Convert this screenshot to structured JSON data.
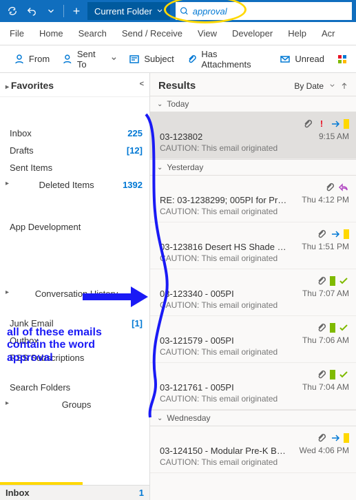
{
  "titlebar": {
    "folder_dd": "Current Folder",
    "search_value": "approval"
  },
  "menu": {
    "file": "File",
    "home": "Home",
    "search": "Search",
    "sendrec": "Send / Receive",
    "view": "View",
    "developer": "Developer",
    "help": "Help",
    "acr": "Acr"
  },
  "toolbar": {
    "from": "From",
    "sentto": "Sent To",
    "subject": "Subject",
    "attach": "Has Attachments",
    "unread": "Unread"
  },
  "nav": {
    "favorites": "Favorites",
    "inbox_bottom": "Inbox",
    "inbox_bottom_count": "1",
    "folders": [
      {
        "name": "Inbox",
        "count": "225",
        "exp": false
      },
      {
        "name": "Drafts",
        "count": "[12]",
        "exp": false
      },
      {
        "name": "Sent Items",
        "count": "",
        "exp": false
      },
      {
        "name": "Deleted Items",
        "count": "1392",
        "exp": true
      },
      {
        "name": "App Development",
        "count": "",
        "exp": false
      },
      {
        "name": "Conversation History",
        "count": "",
        "exp": true
      },
      {
        "name": "Junk Email",
        "count": "[1]",
        "exp": false
      },
      {
        "name": "Outbox",
        "count": "",
        "exp": false
      },
      {
        "name": "RSS Subscriptions",
        "count": "",
        "exp": false
      },
      {
        "name": "Search Folders",
        "count": "",
        "exp": false
      },
      {
        "name": "Groups",
        "count": "",
        "exp": true
      }
    ]
  },
  "results": {
    "title": "Results",
    "sort": "By Date",
    "groups": {
      "today": "Today",
      "yesterday": "Yesterday",
      "wednesday": "Wednesday"
    },
    "caution": "CAUTION: This email originated",
    "emails": {
      "e1": {
        "subject": "03-123802",
        "time": "9:15 AM"
      },
      "e2": {
        "subject": "RE: 03-1238299; 005PI for Proc…",
        "time": "Thu 4:12 PM"
      },
      "e3": {
        "subject": "03-123816 Desert HS Shade St…",
        "time": "Thu 1:51 PM"
      },
      "e4": {
        "subject": "03-123340 - 005PI",
        "time": "Thu 7:07 AM"
      },
      "e5": {
        "subject": "03-121579 - 005PI",
        "time": "Thu 7:06 AM"
      },
      "e6": {
        "subject": "03-121761 - 005PI",
        "time": "Thu 7:04 AM"
      },
      "e7": {
        "subject": "03-124150 - Modular Pre-K Bui…",
        "time": "Wed 4:06 PM"
      }
    }
  },
  "annotation": {
    "line1": "all of these emails",
    "line2": "contain the word",
    "line3": "approval"
  }
}
